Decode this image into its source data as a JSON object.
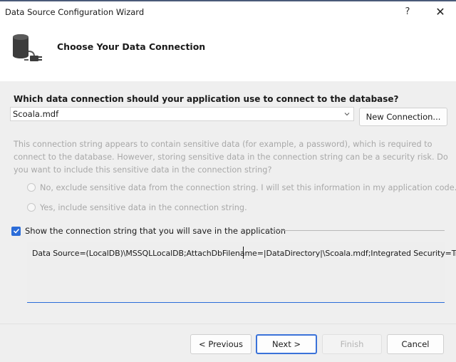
{
  "window": {
    "title": "Data Source Configuration Wizard",
    "help_label": "?",
    "close_label": "✕"
  },
  "header": {
    "title": "Choose Your Data Connection",
    "icon": "database-connection-icon"
  },
  "connection": {
    "question": "Which data connection should your application use to connect to the database?",
    "selected": "Scoala.mdf",
    "new_connection_label": "New Connection..."
  },
  "sensitive": {
    "description": "This connection string appears to contain sensitive data (for example, a password), which is required to connect to the database. However, storing sensitive data in the connection string can be a security risk. Do you want to include this sensitive data in the connection string?",
    "option_no": "No, exclude sensitive data from the connection string. I will set this information in my application code.",
    "option_yes": "Yes, include sensitive data in the connection string."
  },
  "show_string": {
    "label": "Show the connection string that you will save in the application",
    "checked": true,
    "text_before_caret": "Data Source=(LocalDB)\\MSSQLLocalDB;AttachDbFilename",
    "text_after_caret": "=|DataDirectory|\\Scoala.mdf;Integrated Security=True"
  },
  "buttons": {
    "previous": "< Previous",
    "next": "Next >",
    "finish": "Finish",
    "cancel": "Cancel"
  },
  "colors": {
    "accent": "#2b6cd8",
    "disabled_text": "#a8a8a8"
  }
}
